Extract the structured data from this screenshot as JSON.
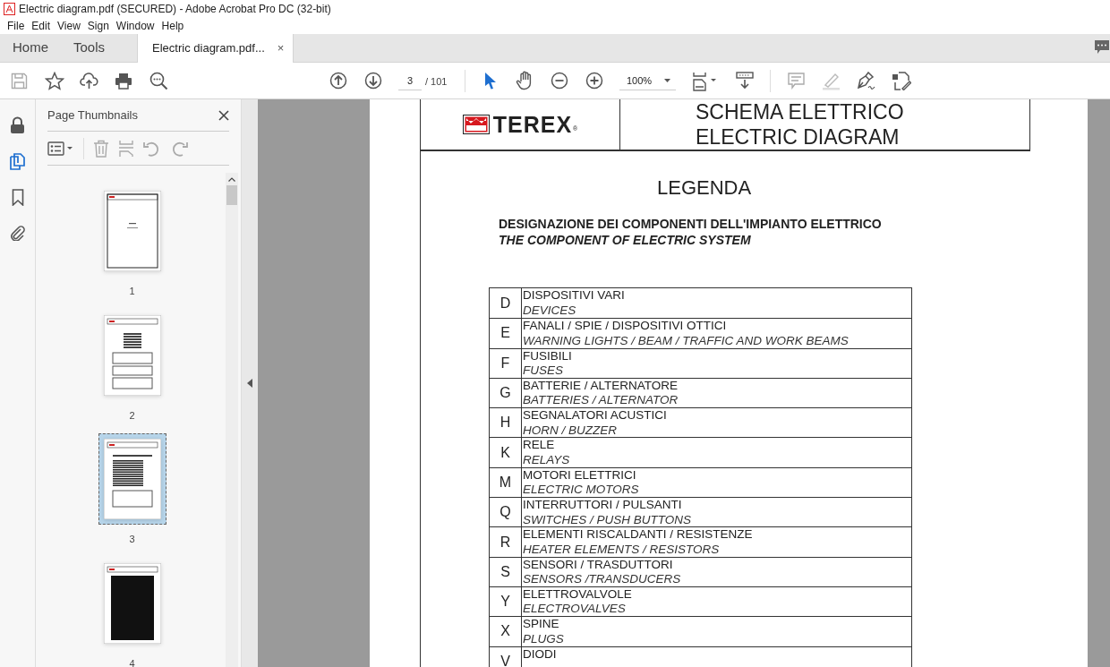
{
  "window": {
    "title": "Electric diagram.pdf (SECURED) - Adobe Acrobat Pro DC (32-bit)"
  },
  "menu": [
    "File",
    "Edit",
    "View",
    "Sign",
    "Window",
    "Help"
  ],
  "tabs": [
    {
      "label": "Home",
      "selected": false
    },
    {
      "label": "Tools",
      "selected": false
    },
    {
      "label": "Electric diagram.pdf...",
      "selected": true,
      "close": "×"
    }
  ],
  "toolbar": {
    "page_number": "3",
    "page_total": "/ 101",
    "zoom": "100%"
  },
  "sidebar": {
    "title": "Page Thumbnails",
    "thumbnails": [
      {
        "label": "1",
        "selected": false
      },
      {
        "label": "2",
        "selected": false
      },
      {
        "label": "3",
        "selected": true
      },
      {
        "label": "4",
        "selected": false
      }
    ]
  },
  "document": {
    "logo": "TEREX",
    "logo_mark": "®",
    "heading_lines": [
      "SCHEMA ELETTRICO",
      "ELECTRIC DIAGRAM"
    ],
    "title": "LEGENDA",
    "subtitle": "DESIGNAZIONE DEI COMPONENTI DELL'IMPIANTO ELETTRICO",
    "subtitle_en": "THE COMPONENT OF ELECTRIC SYSTEM",
    "rows": [
      {
        "code": "D",
        "it": "DISPOSITIVI VARI",
        "en": "DEVICES"
      },
      {
        "code": "E",
        "it": "FANALI / SPIE / DISPOSITIVI OTTICI",
        "en": "WARNING LIGHTS / BEAM / TRAFFIC AND WORK BEAMS"
      },
      {
        "code": "F",
        "it": "FUSIBILI",
        "en": "FUSES"
      },
      {
        "code": "G",
        "it": "BATTERIE / ALTERNATORE",
        "en": "BATTERIES / ALTERNATOR"
      },
      {
        "code": "H",
        "it": "SEGNALATORI ACUSTICI",
        "en": "HORN / BUZZER"
      },
      {
        "code": "K",
        "it": "RELE",
        "en": "RELAYS"
      },
      {
        "code": "M",
        "it": "MOTORI ELETTRICI",
        "en": "ELECTRIC MOTORS"
      },
      {
        "code": "Q",
        "it": "INTERRUTTORI / PULSANTI",
        "en": "SWITCHES / PUSH BUTTONS"
      },
      {
        "code": "R",
        "it": "ELEMENTI RISCALDANTI / RESISTENZE",
        "en": "HEATER ELEMENTS / RESISTORS"
      },
      {
        "code": "S",
        "it": "SENSORI / TRASDUTTORI",
        "en": "SENSORS /TRANSDUCERS"
      },
      {
        "code": "Y",
        "it": "ELETTROVALVOLE",
        "en": "ELECTROVALVES"
      },
      {
        "code": "X",
        "it": "SPINE",
        "en": "PLUGS"
      },
      {
        "code": "V",
        "it": "DIODI"
      }
    ]
  }
}
